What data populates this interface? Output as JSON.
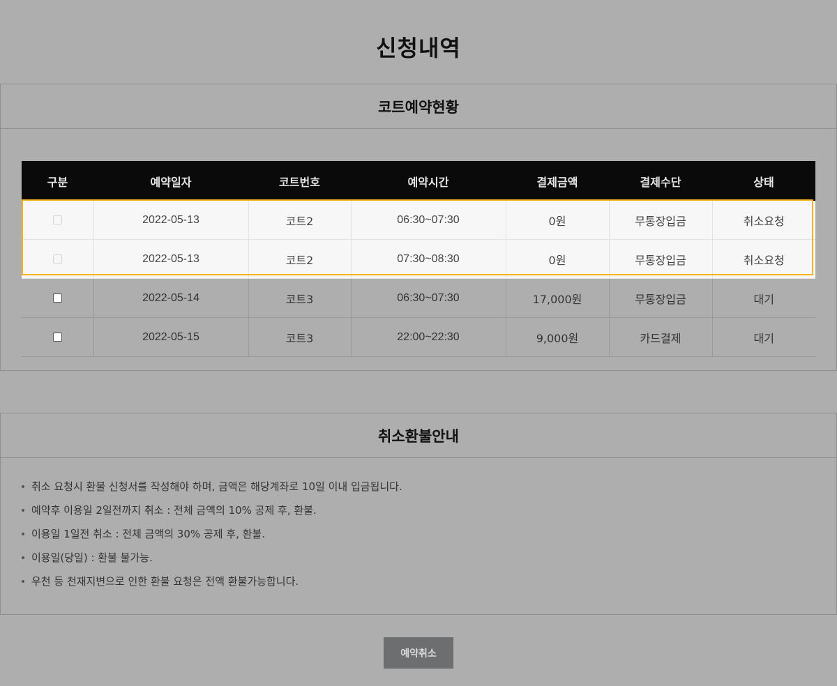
{
  "page_title": "신청내역",
  "reservations": {
    "title": "코트예약현황",
    "columns": [
      "구분",
      "예약일자",
      "코트번호",
      "예약시간",
      "결제금액",
      "결제수단",
      "상태"
    ],
    "rows": [
      {
        "date": "2022-05-13",
        "court": "코트2",
        "time": "06:30~07:30",
        "amount": "0원",
        "method": "무통장입금",
        "status": "취소요청"
      },
      {
        "date": "2022-05-13",
        "court": "코트2",
        "time": "07:30~08:30",
        "amount": "0원",
        "method": "무통장입금",
        "status": "취소요청"
      },
      {
        "date": "2022-05-14",
        "court": "코트3",
        "time": "06:30~07:30",
        "amount": "17,000원",
        "method": "무통장입금",
        "status": "대기"
      },
      {
        "date": "2022-05-15",
        "court": "코트3",
        "time": "22:00~22:30",
        "amount": "9,000원",
        "method": "카드결제",
        "status": "대기"
      }
    ]
  },
  "refund": {
    "title": "취소환불안내",
    "items": [
      "취소 요청시 환불 신청서를 작성해야 하며, 금액은 해당계좌로 10일 이내 입금됩니다.",
      "예약후 이용일 2일전까지 취소 : 전체 금액의 10% 공제 후, 환불.",
      "이용일 1일전 취소 : 전체 금액의 30% 공제 후, 환불.",
      "이용일(당일) : 환불 불가능.",
      "우천 등 천재지변으로 인한 환불 요청은 전액 환불가능합니다."
    ]
  },
  "cancel_button": "예약취소",
  "colors": {
    "highlight_border": "#f5b41e",
    "header_bg": "#0b0a0a",
    "overlay_bg": "#aeaeae"
  }
}
